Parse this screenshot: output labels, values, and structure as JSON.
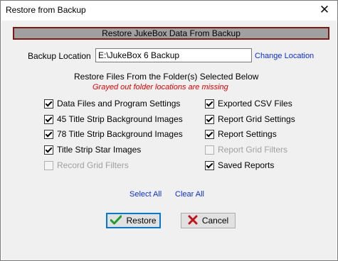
{
  "window": {
    "title": "Restore from Backup"
  },
  "header": {
    "title": "Restore JukeBox Data From Backup"
  },
  "backup": {
    "label": "Backup Location",
    "value": "E:\\JukeBox 6 Backup",
    "change_link": "Change Location"
  },
  "restore_section": {
    "heading": "Restore Files From the Folder(s) Selected  Below",
    "missing_note": "Grayed out folder locations are missing"
  },
  "left_options": [
    {
      "label": "Data Files and Program Settings",
      "checked": true,
      "enabled": true
    },
    {
      "label": "45 Title Strip Background Images",
      "checked": true,
      "enabled": true
    },
    {
      "label": "78 Title Strip Background Images",
      "checked": true,
      "enabled": true
    },
    {
      "label": "Title Strip Star Images",
      "checked": true,
      "enabled": true
    },
    {
      "label": "Record Grid Filters",
      "checked": false,
      "enabled": false
    }
  ],
  "right_options": [
    {
      "label": "Exported CSV Files",
      "checked": true,
      "enabled": true
    },
    {
      "label": "Report Grid Settings",
      "checked": true,
      "enabled": true
    },
    {
      "label": "Report Settings",
      "checked": true,
      "enabled": true
    },
    {
      "label": "Report Grid Filters",
      "checked": false,
      "enabled": false
    },
    {
      "label": "Saved Reports",
      "checked": true,
      "enabled": true
    }
  ],
  "selection_links": {
    "select_all": "Select All",
    "clear_all": "Clear All"
  },
  "buttons": {
    "restore": "Restore",
    "cancel": "Cancel"
  },
  "colors": {
    "header_border": "#7a1a14",
    "link": "#0a2fd8",
    "warning": "#e60000",
    "check_icon": "#1e9e2a",
    "cancel_icon": "#c0141a"
  },
  "icons": {
    "close": "close-icon",
    "restore": "green-check-icon",
    "cancel": "red-x-icon"
  }
}
